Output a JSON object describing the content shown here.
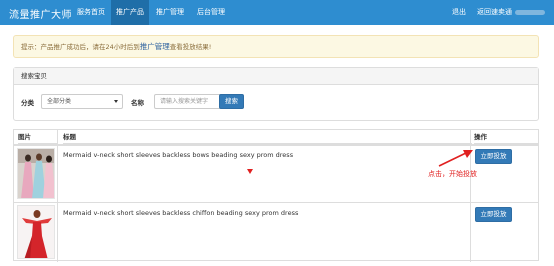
{
  "navbar": {
    "brand": "流量推广大师",
    "items": [
      {
        "label": "服务首页"
      },
      {
        "label": "推广产品"
      },
      {
        "label": "推广管理"
      },
      {
        "label": "后台管理"
      }
    ],
    "logout": "退出",
    "back": "返回速卖通"
  },
  "alert": {
    "prefix": "提示：产品推广成功后，请在24小时后到",
    "link": "推广管理",
    "suffix": "查看投放结果!"
  },
  "search_panel": {
    "heading": "搜索宝贝",
    "category_label": "分类",
    "category_value": "全部分类",
    "name_label": "名称",
    "name_placeholder": "请输入搜索关键字",
    "search_button": "搜索"
  },
  "table": {
    "headers": {
      "image": "图片",
      "title": "标题",
      "action": "操作"
    },
    "rows": [
      {
        "title": "Mermaid v-neck short sleeves backless bows beading sexy prom dress",
        "button": "立即投放"
      },
      {
        "title": "Mermaid v-neck short sleeves backless chiffon beading sexy prom dress",
        "button": "立即投放"
      }
    ]
  },
  "annotation": {
    "text": "点击，开始投放",
    "color": "#e02020"
  },
  "colors": {
    "navbar": "#2e8dd0",
    "accent": "#337ab7",
    "alert_bg": "#fcf8e3"
  }
}
